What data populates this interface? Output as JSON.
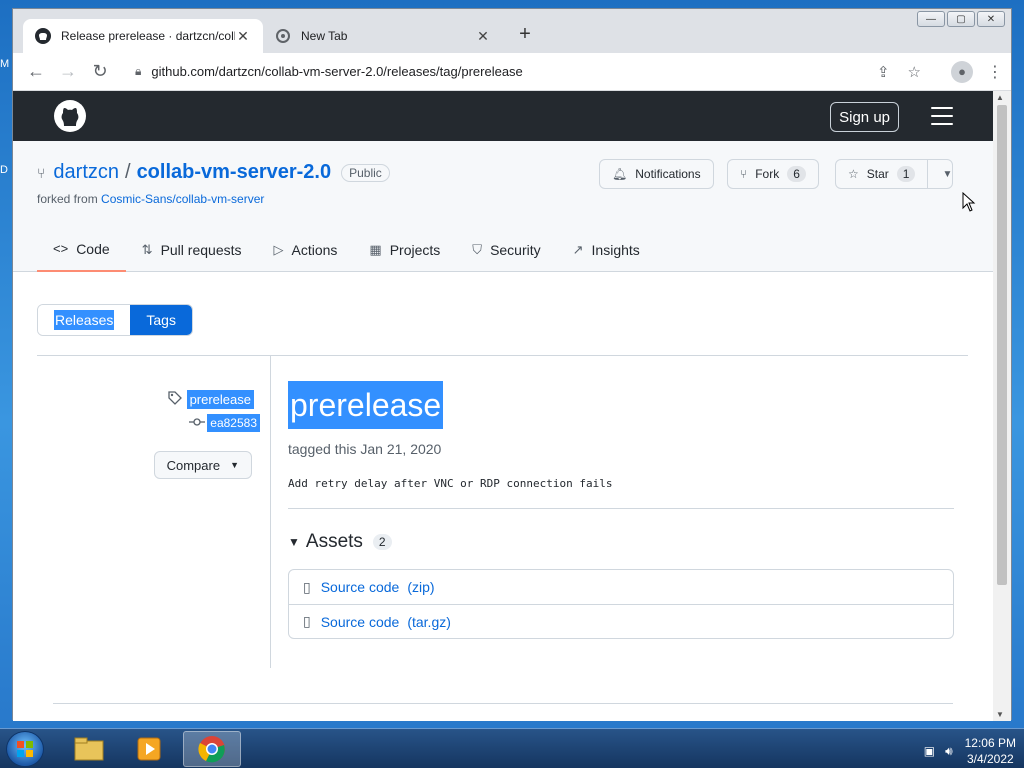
{
  "desktop": {
    "label_m": "M",
    "label_d": "D"
  },
  "browser": {
    "tabs": [
      {
        "title": "Release prerelease · dartzcn/colla",
        "close": "✕"
      },
      {
        "title": "New Tab",
        "close": "✕"
      }
    ],
    "new_tab": "+",
    "window_controls": {
      "minimize": "—",
      "maximize": "▢",
      "close": "✕"
    },
    "url": "github.com/dartzcn/collab-vm-server-2.0/releases/tag/prerelease"
  },
  "github": {
    "signup": "Sign up",
    "repo": {
      "owner": "dartzcn",
      "separator": "/",
      "name": "collab-vm-server-2.0",
      "visibility": "Public",
      "forked_prefix": "forked from ",
      "forked_from": "Cosmic-Sans/collab-vm-server"
    },
    "buttons": {
      "notifications": "Notifications",
      "fork": "Fork",
      "fork_count": "6",
      "star": "Star",
      "star_count": "1"
    },
    "nav": [
      {
        "label": "Code",
        "icon": "<>"
      },
      {
        "label": "Pull requests",
        "icon": "⇅"
      },
      {
        "label": "Actions",
        "icon": "▷"
      },
      {
        "label": "Projects",
        "icon": "▦"
      },
      {
        "label": "Security",
        "icon": "⛉"
      },
      {
        "label": "Insights",
        "icon": "↗"
      }
    ],
    "segment": {
      "releases": "Releases",
      "tags": "Tags"
    },
    "release": {
      "tag": "prerelease",
      "commit": "ea82583",
      "compare": "Compare",
      "title": "prerelease",
      "tagged": "tagged this Jan 21, 2020",
      "body": "Add retry delay after VNC or RDP connection fails",
      "assets_heading": "Assets",
      "assets_count": "2",
      "assets": [
        {
          "label": "Source code",
          "format": "(zip)"
        },
        {
          "label": "Source code",
          "format": "(tar.gz)"
        }
      ]
    }
  },
  "taskbar": {
    "time": "12:06 PM",
    "date": "3/4/2022"
  },
  "colors": {
    "accent": "#0969da",
    "header": "#24292f",
    "selection": "#3390ff",
    "nav_underline": "#fd8c73"
  }
}
